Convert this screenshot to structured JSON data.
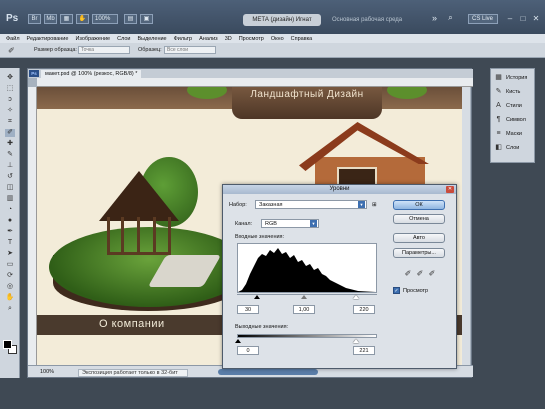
{
  "app": {
    "logo": "Ps",
    "zoom": "100%",
    "workspace_button": "МЕТА (дизайн) Игнат",
    "workspace_link": "Основная рабочая среда",
    "cs_live": "CS Live"
  },
  "menu": [
    "Файл",
    "Редактирование",
    "Изображение",
    "Слои",
    "Выделение",
    "Фильтр",
    "Анализ",
    "3D",
    "Просмотр",
    "Окно",
    "Справка"
  ],
  "options": {
    "sample_size_label": "Размер образца:",
    "sample_size_value": "Точка",
    "sample_label": "Образец:",
    "sample_value": "Все слои"
  },
  "document": {
    "tab_title": "макет.psd @ 100% (резкос, RGB/8) *",
    "status_zoom": "100%",
    "status_info": "Экспозиция работает только в 32-бит",
    "canvas": {
      "logo_text": "Ландшафтный Дизайн",
      "about_text": "О компании"
    }
  },
  "levels_dialog": {
    "title": "Уровни",
    "preset_label": "Набор:",
    "preset_value": "Заказная",
    "channel_label": "Канал:",
    "channel_value": "RGB",
    "input_label": "Входные значения:",
    "input_black": "30",
    "input_gamma": "1,00",
    "input_white": "220",
    "output_label": "Выходные значения:",
    "output_black": "0",
    "output_white": "221",
    "ok": "ОК",
    "cancel": "Отмена",
    "auto": "Авто",
    "options": "Параметры...",
    "preview": "Просмотр"
  },
  "right_panel": [
    {
      "icon": "histogram-icon",
      "glyph": "▦",
      "label": "История"
    },
    {
      "icon": "brush-icon",
      "glyph": "✎",
      "label": "Кисть"
    },
    {
      "icon": "text-icon",
      "glyph": "A",
      "label": "Стили"
    },
    {
      "icon": "char-icon",
      "glyph": "¶",
      "label": "Символ"
    },
    {
      "icon": "paragraph-icon",
      "glyph": "≡",
      "label": "Маски"
    },
    {
      "icon": "layers-icon",
      "glyph": "◧",
      "label": "Слои"
    }
  ]
}
